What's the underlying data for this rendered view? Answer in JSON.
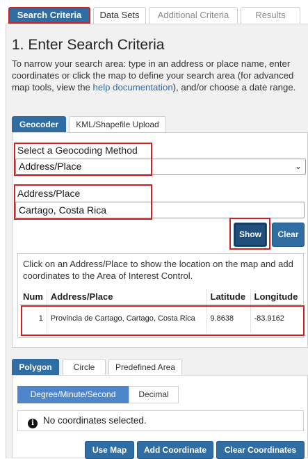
{
  "main_tabs": [
    {
      "label": "Search Criteria",
      "active": true
    },
    {
      "label": "Data Sets"
    },
    {
      "label": "Additional Criteria"
    },
    {
      "label": "Results"
    }
  ],
  "heading": "1. Enter Search Criteria",
  "intro": {
    "before_link": "To narrow your search area: type in an address or place name, enter coordinates or click the map to define your search area (for advanced map tools, view the ",
    "link": "help documentation",
    "after_link": "), and/or choose a date range."
  },
  "sub_tabs": [
    {
      "label": "Geocoder",
      "active": true
    },
    {
      "label": "KML/Shapefile Upload"
    }
  ],
  "geocoder": {
    "method_label": "Select a Geocoding Method",
    "method_value": "Address/Place",
    "place_label": "Address/Place",
    "place_value": "Cartago, Costa Rica",
    "show_label": "Show",
    "clear_label": "Clear",
    "results_instructions": "Click on an Address/Place to show the location on the map and add coordinates to the Area of Interest Control.",
    "results_table": {
      "headers": [
        "Num",
        "Address/Place",
        "Latitude",
        "Longitude"
      ],
      "rows": [
        {
          "num": "1",
          "place": "Provincia de Cartago, Cartago, Costa Rica",
          "lat": "9.8638",
          "lon": "-83.9162"
        }
      ]
    }
  },
  "area_tabs": [
    {
      "label": "Polygon",
      "active": true
    },
    {
      "label": "Circle"
    },
    {
      "label": "Predefined Area"
    }
  ],
  "coord_format": {
    "options": [
      "Degree/Minute/Second",
      "Decimal"
    ],
    "selected": "Degree/Minute/Second"
  },
  "coordinates": {
    "empty_message": "No coordinates selected."
  },
  "coord_buttons": {
    "use_map": "Use Map",
    "add": "Add Coordinate",
    "clear": "Clear Coordinates"
  },
  "colors": {
    "primary": "#2f6da3",
    "highlight_box": "#d0201f",
    "toggle_active": "#4f86c9"
  }
}
